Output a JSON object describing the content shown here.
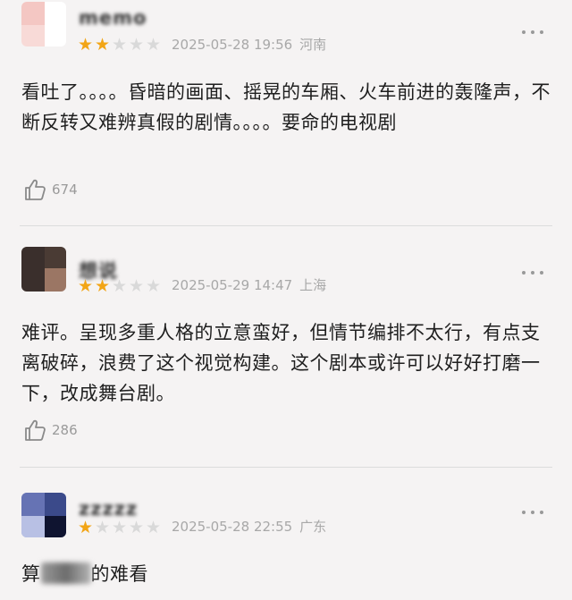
{
  "reviews": [
    {
      "username": "memo",
      "rating": 2,
      "max_rating": 5,
      "date": "2025-05-28 19:56",
      "location": "河南",
      "text": "看吐了。。。。昏暗的画面、摇晃的车厢、火车前进的轰隆声，不断反转又难辨真假的剧情。。。。要命的电视剧",
      "likes": "674",
      "avatar_colors": [
        "#f4c7c3",
        "#ffffff"
      ]
    },
    {
      "username": "想说",
      "rating": 2,
      "max_rating": 5,
      "date": "2025-05-29 14:47",
      "location": "上海",
      "text": "难评。呈现多重人格的立意蛮好，但情节编排不太行，有点支离破碎，浪费了这个视觉构建。这个剧本或许可以好好打磨一下，改成舞台剧。",
      "likes": "286",
      "avatar_colors": [
        "#3a2f2c",
        "#9b7664",
        "#e6d7cf"
      ]
    },
    {
      "username": "zzzzz",
      "rating": 1,
      "max_rating": 5,
      "date": "2025-05-28 22:55",
      "location": "广东",
      "text_before": "算",
      "text_after": "的难看",
      "avatar_colors": [
        "#3b4a8a",
        "#0f1430",
        "#9aa6d4"
      ]
    }
  ],
  "colors": {
    "star_filled": "#f2a516",
    "star_empty": "#d9d9d9",
    "meta": "#a8a8a8",
    "divider": "#dcdcdc"
  },
  "icons": {
    "like": "thumbs-up-icon",
    "more": "more-dots-icon"
  }
}
